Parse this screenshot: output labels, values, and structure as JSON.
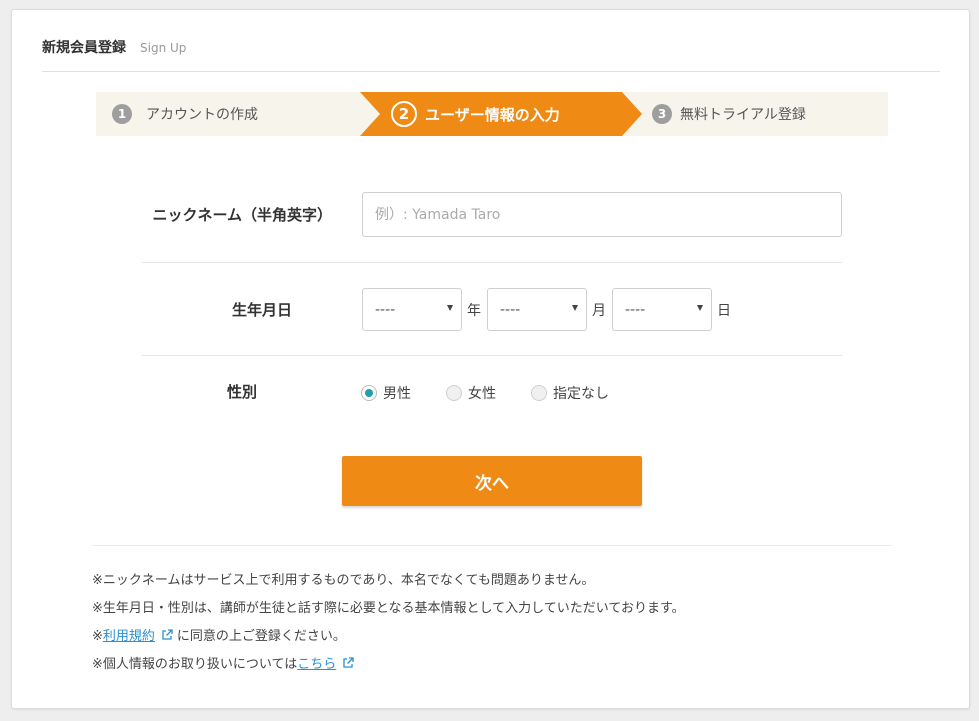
{
  "header": {
    "title": "新規会員登録",
    "subtitle": "Sign Up"
  },
  "steps": [
    {
      "num": "1",
      "label": "アカウントの作成"
    },
    {
      "num": "2",
      "label": "ユーザー情報の入力"
    },
    {
      "num": "3",
      "label": "無料トライアル登録"
    }
  ],
  "form": {
    "nickname": {
      "label": "ニックネーム（半角英字）",
      "placeholder": "例）: Yamada Taro",
      "value": ""
    },
    "birthday": {
      "label": "生年月日",
      "year": "----",
      "year_unit": "年",
      "month": "----",
      "month_unit": "月",
      "day": "----",
      "day_unit": "日"
    },
    "gender": {
      "label": "性別",
      "options": [
        "男性",
        "女性",
        "指定なし"
      ],
      "selected": "男性"
    },
    "next_button": "次へ"
  },
  "notes": {
    "n1": "※ニックネームはサービス上で利用するものであり、本名でなくても問題ありません。",
    "n2": "※生年月日・性別は、講師が生徒と話す際に必要となる基本情報として入力していただいております。",
    "n3_prefix": "※",
    "n3_link": "利用規約",
    "n3_suffix": "に同意の上ご登録ください。",
    "n4_prefix": "※個人情報のお取り扱いについては",
    "n4_link": "こちら"
  },
  "colors": {
    "accent": "#ef8a14",
    "radio": "#21a0a8",
    "link": "#2a8fd0",
    "step_bg": "#f7f4ec"
  }
}
